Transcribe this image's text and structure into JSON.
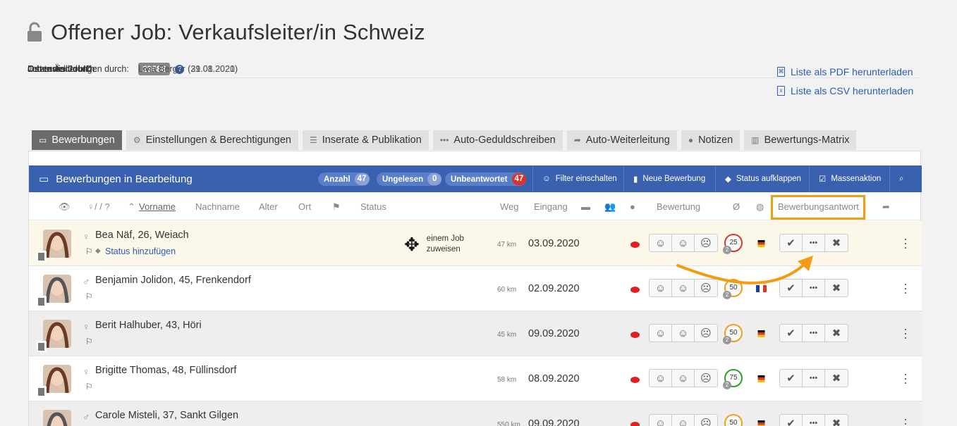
{
  "page": {
    "title": "Offener Job: Verkaufsleiter/in Schweiz"
  },
  "meta": {
    "jobid_label": "Ostendis JobID:",
    "jobid_value": "23686",
    "created_label": "Job erstellt durch:",
    "created_value": "Livia Berger (31.08.2020)",
    "changed_label": "Letzte Änderungen durch:",
    "changed_value": "Livia Berger (29.01.2021)"
  },
  "downloads": {
    "pdf": "Liste als PDF herunterladen",
    "csv": "Liste als CSV herunterladen"
  },
  "tabs": [
    {
      "label": "Bewerbungen"
    },
    {
      "label": "Einstellungen & Berechtigungen"
    },
    {
      "label": "Inserate & Publikation"
    },
    {
      "label": "Auto-Geduldschreiben"
    },
    {
      "label": "Auto-Weiterleitung"
    },
    {
      "label": "Notizen"
    },
    {
      "label": "Bewertungs-Matrix"
    }
  ],
  "bar": {
    "title": "Bewerbungen in Bearbeitung",
    "anzahl_label": "Anzahl",
    "anzahl": "47",
    "ungelesen_label": "Ungelesen",
    "ungelesen": "0",
    "unbeantwortet_label": "Unbeantwortet",
    "unbeantwortet": "47",
    "filter": "Filter einschalten",
    "neue": "Neue Bewerbung",
    "status": "Status aufklappen",
    "masse": "Massenaktion"
  },
  "columns": {
    "gender": "/ / ?",
    "vorname": "Vorname",
    "nachname": "Nachname",
    "alter": "Alter",
    "ort": "Ort",
    "status": "Status",
    "weg": "Weg",
    "eingang": "Eingang",
    "bewertung": "Bewertung",
    "avg": "Ø",
    "antwort": "Bewerbungsantwort"
  },
  "assign_text_1": "einem Job",
  "assign_text_2": "zuweisen",
  "status_add": "Status hinzufügen",
  "colors": {
    "accent": "#3a61b0",
    "highlight": "#f39c12",
    "unread": "#e02020"
  },
  "rows": [
    {
      "name": "Bea Näf, 26, Weiach",
      "gender": "female",
      "km": "47 km",
      "date": "03.09.2020",
      "score": "25",
      "sub": "2",
      "score_color": "#d9342b",
      "nationality": "de"
    },
    {
      "name": "Benjamin Jolidon, 45, Frenkendorf",
      "gender": "male",
      "km": "60 km",
      "date": "02.09.2020",
      "score": "50",
      "sub": "2",
      "score_color": "#f39c12",
      "nationality": "fr"
    },
    {
      "name": "Berit Halhuber, 43, Höri",
      "gender": "female",
      "km": "45 km",
      "date": "09.09.2020",
      "score": "50",
      "sub": "2",
      "score_color": "#f39c12",
      "nationality": "de"
    },
    {
      "name": "Brigitte Thomas, 48, Füllinsdorf",
      "gender": "female",
      "km": "58 km",
      "date": "08.09.2020",
      "score": "75",
      "sub": "2",
      "score_color": "#2ca02c",
      "nationality": "de"
    },
    {
      "name": "Carole Misteli, 37, Sankt Gilgen",
      "gender": "male",
      "km": "550 km",
      "date": "09.09.2020",
      "score": "50",
      "sub": "2",
      "score_color": "#f39c12",
      "nationality": "de"
    }
  ]
}
